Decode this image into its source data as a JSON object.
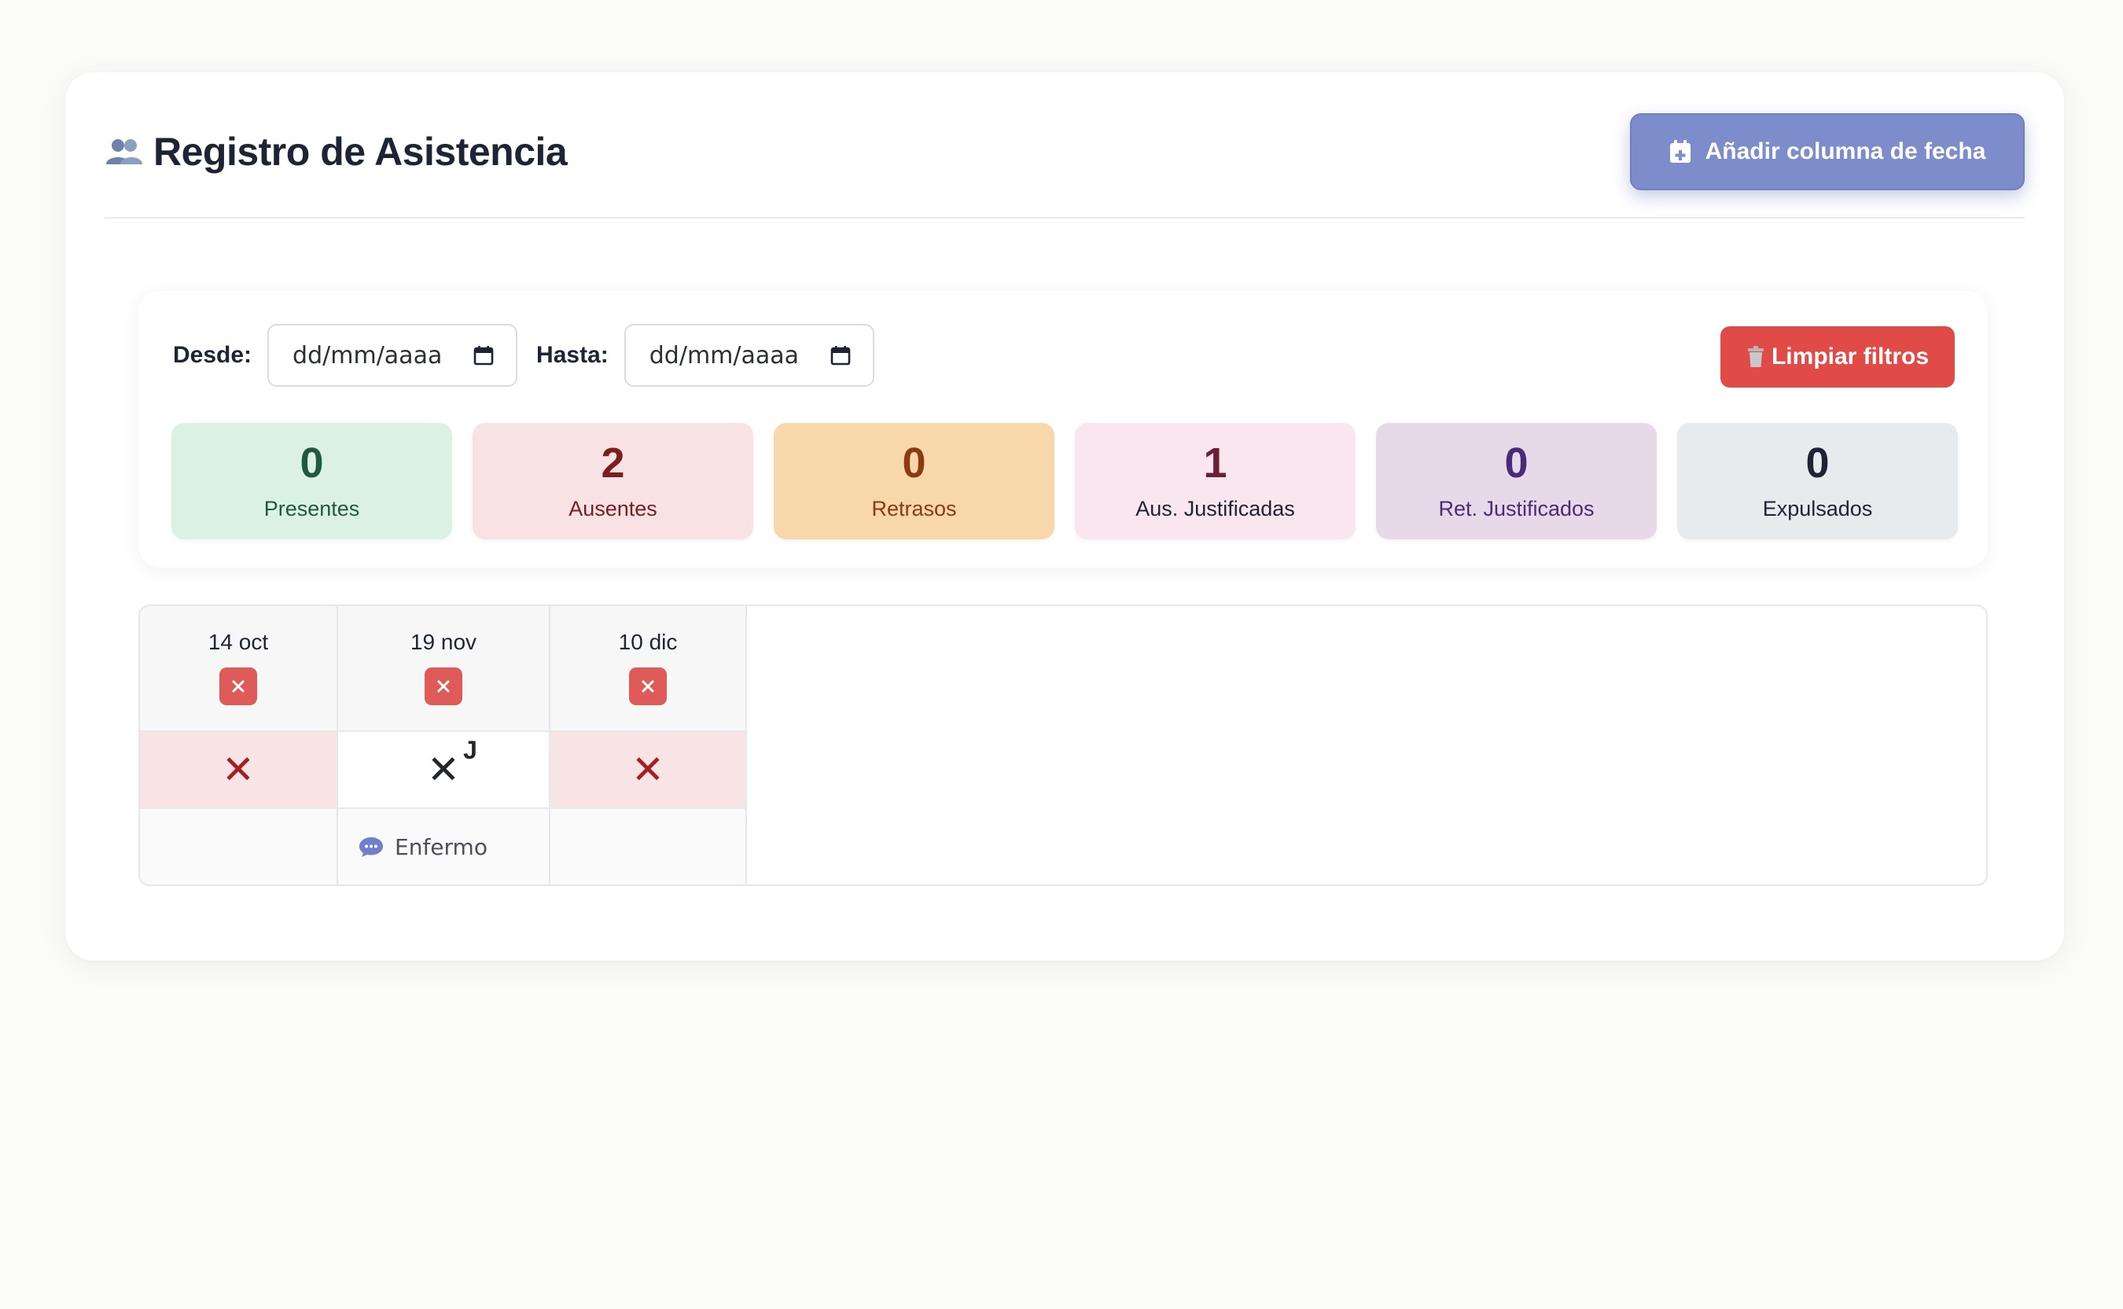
{
  "header": {
    "title": "Registro de Asistencia",
    "add_column_label": "Añadir columna de fecha"
  },
  "filters": {
    "from_label": "Desde:",
    "from_value": "dd/mm/aaaa",
    "to_label": "Hasta:",
    "to_value": "dd/mm/aaaa",
    "clear_label": "Limpiar filtros"
  },
  "stats": [
    {
      "value": "0",
      "label": "Presentes",
      "bg": "#dbf1e4",
      "fg": "#1f5b3a"
    },
    {
      "value": "2",
      "label": "Ausentes",
      "bg": "#f8e2e3",
      "fg": "#7a1e1f"
    },
    {
      "value": "0",
      "label": "Retrasos",
      "bg": "#f8d7ab",
      "fg": "#8a3b14"
    },
    {
      "value": "1",
      "label": "Aus. Justificadas",
      "bg": "#f9e6ef",
      "fg": "#6c1e35"
    },
    {
      "value": "0",
      "label": "Ret. Justificados",
      "bg": "#e7d9e7",
      "fg": "#4b2a7a"
    },
    {
      "value": "0",
      "label": "Expulsados",
      "bg": "#e8ebee",
      "fg": "#1d2433"
    }
  ],
  "table": {
    "columns": [
      {
        "date": "14 oct",
        "status": "absent",
        "mark": "✕",
        "note": ""
      },
      {
        "date": "19 nov",
        "status": "justified",
        "mark": "✕",
        "mark_sup": "J",
        "note": "Enfermo"
      },
      {
        "date": "10 dic",
        "status": "absent",
        "mark": "✕",
        "note": ""
      }
    ]
  },
  "icons": {
    "title": "people-icon",
    "add_column": "calendar-plus-icon",
    "date_picker": "calendar-icon",
    "clear": "trash-icon",
    "delete_column": "close-icon",
    "note": "comment-icon"
  },
  "colors": {
    "primary": "#7d8ccb",
    "danger": "#e04b48",
    "absent_bg": "#f8e4e4",
    "absent_mark": "#a31f23"
  }
}
